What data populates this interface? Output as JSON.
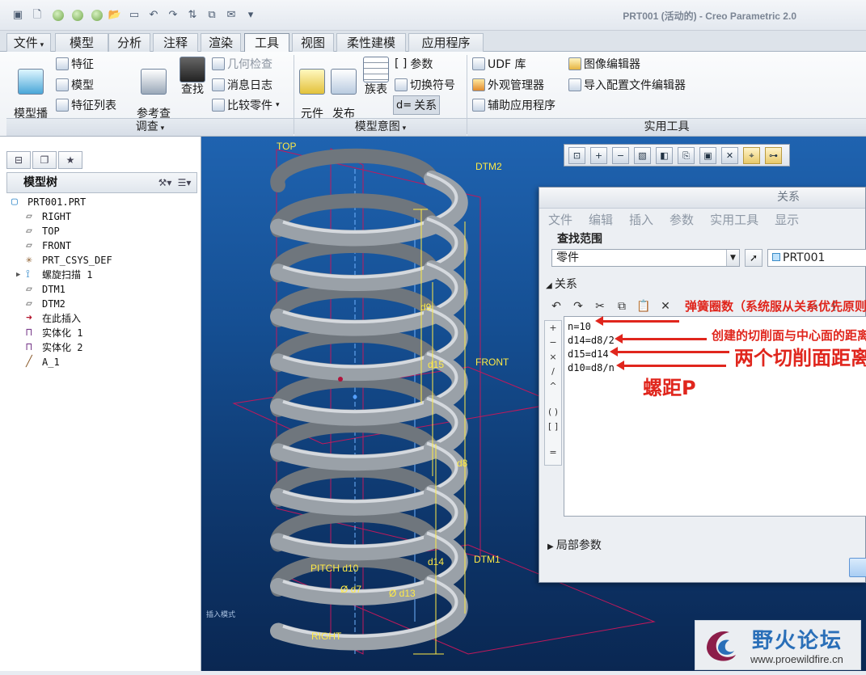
{
  "window": {
    "title": "PRT001 (活动的) - Creo Parametric 2.0"
  },
  "tabs": [
    {
      "label": "文件",
      "has_menu": true
    },
    {
      "label": "模型"
    },
    {
      "label": "分析"
    },
    {
      "label": "注释"
    },
    {
      "label": "渲染"
    },
    {
      "label": "工具",
      "active": true
    },
    {
      "label": "视图"
    },
    {
      "label": "柔性建模"
    },
    {
      "label": "应用程序"
    }
  ],
  "ribbon": {
    "model_player": "模型播\n放器",
    "feature": "特征",
    "model": "模型",
    "feature_list": "特征列表",
    "ref_viewer": "参考查\n看器",
    "find": "查找",
    "geometry_check": "几何检查",
    "message_log": "消息日志",
    "compare_part": "比较零件",
    "component_interface": "元件\n界面",
    "publish_geometry": "发布\n几何",
    "family_table": "族表",
    "parameters": "参数",
    "switch_symbols": "切换符号",
    "relations": "关系",
    "udf_library": "UDF 库",
    "appearance_manager": "外观管理器",
    "auxiliary_apps": "辅助应用程序",
    "image_editor": "图像编辑器",
    "import_config_editor": "导入配置文件编辑器",
    "groups": {
      "investigate": "调查",
      "model_intent": "模型意图",
      "utilities": "实用工具"
    }
  },
  "model_tree": {
    "title": "模型树",
    "nodes": [
      {
        "label": "PRT001.PRT",
        "icon": "part-icon",
        "indent": 0
      },
      {
        "label": "RIGHT",
        "icon": "datum-plane-icon",
        "indent": 1
      },
      {
        "label": "TOP",
        "icon": "datum-plane-icon",
        "indent": 1
      },
      {
        "label": "FRONT",
        "icon": "datum-plane-icon",
        "indent": 1
      },
      {
        "label": "PRT_CSYS_DEF",
        "icon": "csys-icon",
        "indent": 1
      },
      {
        "label": "螺旋扫描 1",
        "icon": "helical-sweep-icon",
        "indent": 1,
        "expandable": true
      },
      {
        "label": "DTM1",
        "icon": "datum-plane-icon",
        "indent": 1
      },
      {
        "label": "DTM2",
        "icon": "datum-plane-icon",
        "indent": 1
      },
      {
        "label": "在此插入",
        "icon": "insert-here-icon",
        "indent": 1
      },
      {
        "label": "实体化 1",
        "icon": "solidify-icon",
        "indent": 1
      },
      {
        "label": "实体化 2",
        "icon": "solidify-icon",
        "indent": 1
      },
      {
        "label": "A_1",
        "icon": "axis-icon",
        "indent": 1
      }
    ]
  },
  "viewport": {
    "planes": {
      "top": "TOP",
      "dtm2": "DTM2",
      "front": "FRONT",
      "dtm1": "DTM1",
      "right": "RIGHT"
    },
    "dims": {
      "d9": "d9",
      "d15": "d15",
      "d8": "d8",
      "d14": "d14",
      "pitch": "PITCH d10",
      "d7": "Ø d7",
      "d13": "Ø d13"
    },
    "mode_status": "插入模式",
    "colors": {
      "background_top": "#1f63b0",
      "background_bottom": "#0a2752",
      "spring": "#8e959c",
      "dimension": "#ffea45",
      "plane_edge": "#c2185b"
    }
  },
  "relations_dialog": {
    "title": "关系",
    "menu": [
      "文件",
      "编辑",
      "插入",
      "参数",
      "实用工具",
      "显示"
    ],
    "find_scope_label": "查找范围",
    "scope_value": "零件",
    "model_value": "PRT001",
    "relations_section": "关系",
    "lines": [
      "n=10",
      "d14=d8/2",
      "d15=d14",
      "d10=d8/n"
    ],
    "local_params": "局部参数"
  },
  "annotations": {
    "spring_turns": "弹簧圈数（系统服从关系优先原则）",
    "cut_plane_distance": "创建的切削面与中心面的距离",
    "two_cut_planes": "两个切削面距离",
    "pitch": "螺距P",
    "color": "#e0261d"
  },
  "watermark": {
    "name": "野火论坛",
    "url": "www.proewildfire.cn"
  }
}
